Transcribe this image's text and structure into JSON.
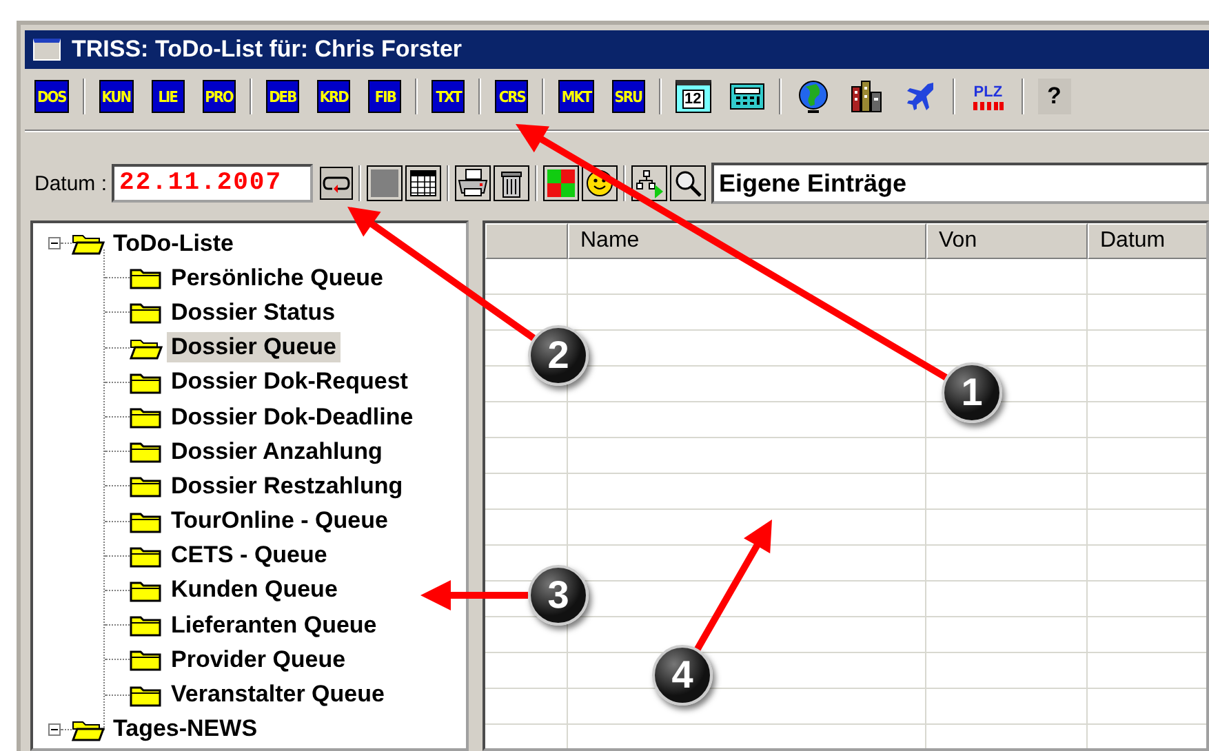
{
  "window": {
    "title": "TRISS: ToDo-List für: Chris Forster"
  },
  "main_toolbar": {
    "groups": [
      [
        {
          "kind": "code",
          "label": "DOS"
        }
      ],
      [
        {
          "kind": "code",
          "label": "KUN"
        },
        {
          "kind": "code",
          "label": "LIE"
        },
        {
          "kind": "code",
          "label": "PRO"
        }
      ],
      [
        {
          "kind": "code",
          "label": "DEB"
        },
        {
          "kind": "code",
          "label": "KRD"
        },
        {
          "kind": "code",
          "label": "FIB"
        }
      ],
      [
        {
          "kind": "code",
          "label": "TXT"
        }
      ],
      [
        {
          "kind": "code",
          "label": "CRS"
        }
      ],
      [
        {
          "kind": "code",
          "label": "MKT"
        },
        {
          "kind": "code",
          "label": "SRU"
        }
      ],
      [
        {
          "kind": "calendar",
          "label": "12"
        },
        {
          "kind": "calculator"
        }
      ],
      [
        {
          "kind": "globe"
        },
        {
          "kind": "buildings"
        },
        {
          "kind": "plane"
        }
      ],
      [
        {
          "kind": "postcode",
          "label": "PLZ"
        }
      ],
      [
        {
          "kind": "help",
          "label": "?"
        }
      ]
    ]
  },
  "date_toolbar": {
    "date_label": "Datum :",
    "date_value": "22.11.2007",
    "groups": [
      [
        {
          "kind": "refresh"
        }
      ],
      [
        {
          "kind": "square"
        },
        {
          "kind": "table"
        }
      ],
      [
        {
          "kind": "printer"
        },
        {
          "kind": "trash"
        }
      ],
      [
        {
          "kind": "colors"
        },
        {
          "kind": "smiley"
        }
      ],
      [
        {
          "kind": "hierarchy"
        },
        {
          "kind": "search"
        }
      ]
    ],
    "filter": {
      "value": "Eigene Einträge"
    }
  },
  "tree": [
    {
      "label": "ToDo-Liste",
      "expanded": true,
      "selected": false,
      "children": [
        {
          "label": "Persönliche Queue",
          "selected": false
        },
        {
          "label": "Dossier Status",
          "selected": false
        },
        {
          "label": "Dossier Queue",
          "selected": true
        },
        {
          "label": "Dossier Dok-Request",
          "selected": false
        },
        {
          "label": "Dossier Dok-Deadline",
          "selected": false
        },
        {
          "label": "Dossier Anzahlung",
          "selected": false
        },
        {
          "label": "Dossier Restzahlung",
          "selected": false
        },
        {
          "label": "TourOnline - Queue",
          "selected": false
        },
        {
          "label": "CETS - Queue",
          "selected": false
        },
        {
          "label": "Kunden Queue",
          "selected": false
        },
        {
          "label": "Lieferanten Queue",
          "selected": false
        },
        {
          "label": "Provider Queue",
          "selected": false
        },
        {
          "label": "Veranstalter Queue",
          "selected": false
        }
      ]
    },
    {
      "label": "Tages-NEWS",
      "expanded": true,
      "selected": false
    }
  ],
  "grid": {
    "columns": [
      {
        "label": "Name"
      },
      {
        "label": "Von"
      },
      {
        "label": "Datum"
      }
    ]
  },
  "callouts": [
    {
      "label": "1"
    },
    {
      "label": "2"
    },
    {
      "label": "3"
    },
    {
      "label": "4"
    }
  ]
}
